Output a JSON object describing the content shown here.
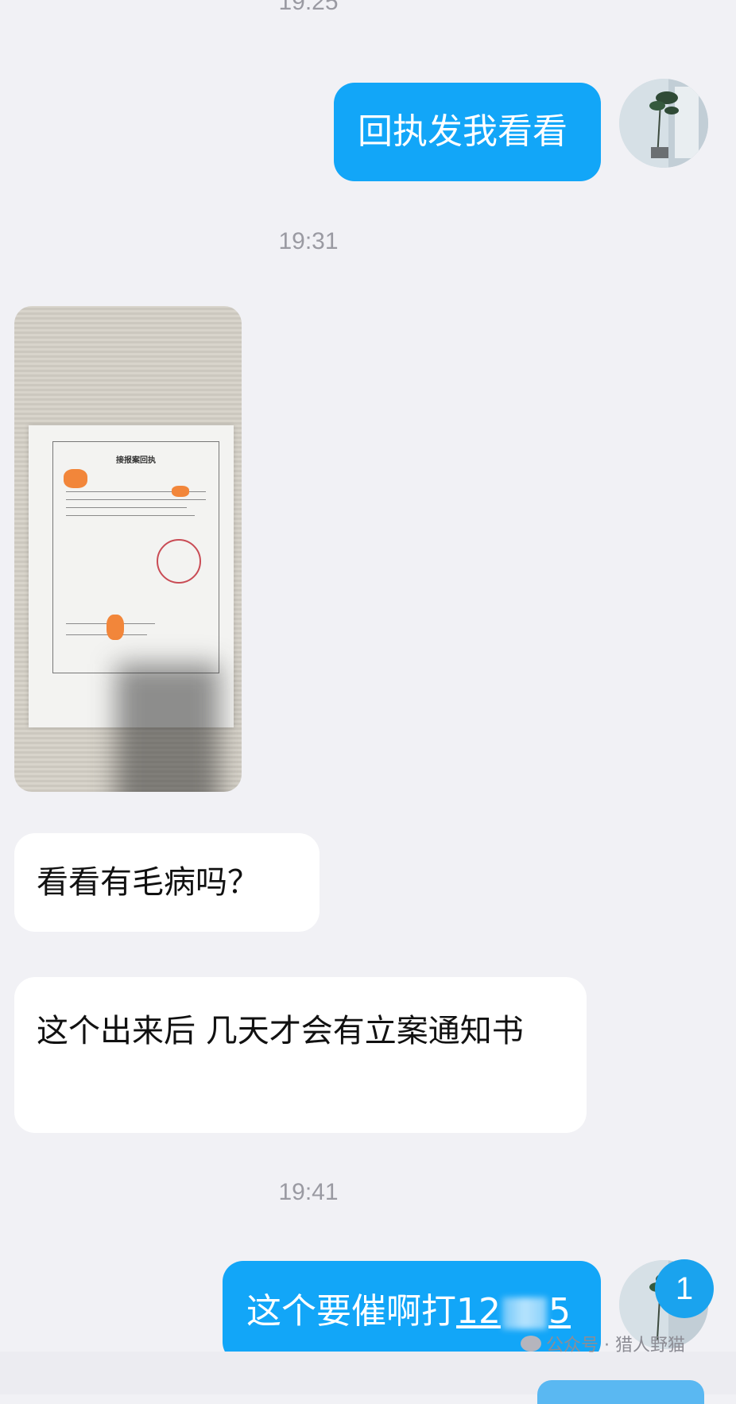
{
  "chat": {
    "timestamp_top": "19:25",
    "messages": [
      {
        "side": "out",
        "text": "回执发我看看"
      },
      {
        "timestamp": "19:31"
      },
      {
        "side": "in",
        "type": "image",
        "image_desc_title": "接报案回执"
      },
      {
        "side": "in",
        "text": "看看有毛病吗？"
      },
      {
        "side": "in",
        "text": "这个出来后 几天才会有立案通知书"
      },
      {
        "timestamp": "19:41"
      },
      {
        "side": "out",
        "text_prefix": "这个要催啊打",
        "link_start": "12",
        "link_end": "5"
      }
    ],
    "unread_badge": "1"
  },
  "watermark": {
    "text": "公众号 · 猎人野猫"
  },
  "colors": {
    "outgoing_bubble": "#12a6f8",
    "incoming_bubble": "#ffffff",
    "background": "#f1f1f5",
    "badge": "#1aa3ee"
  }
}
